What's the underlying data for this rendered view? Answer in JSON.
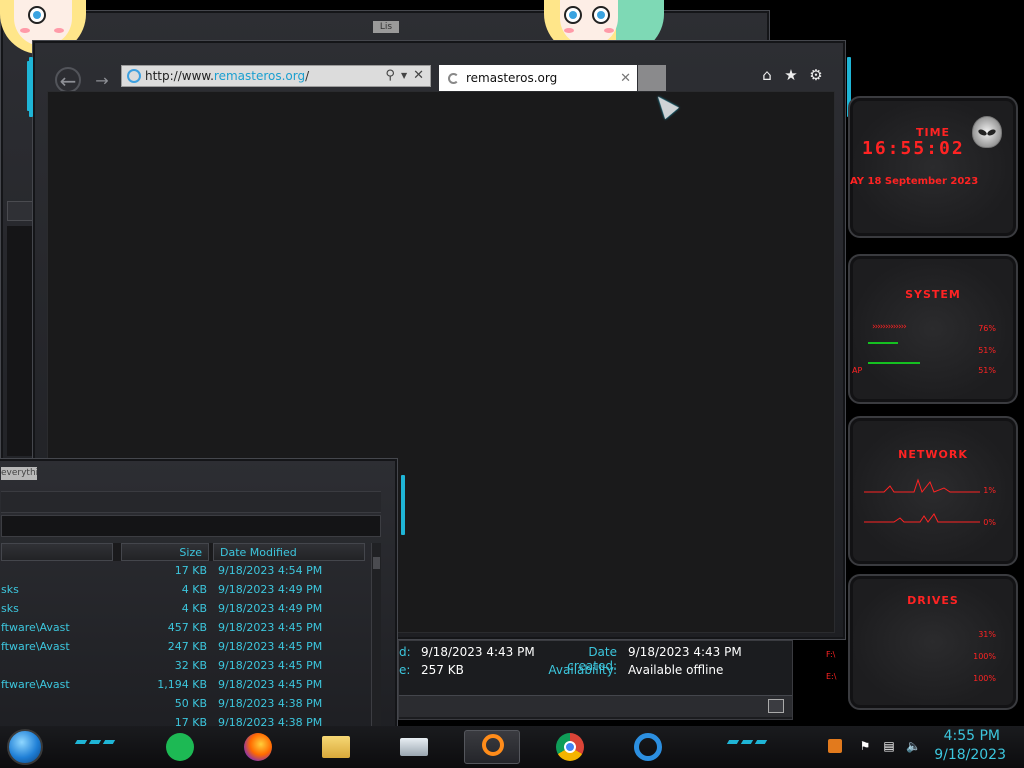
{
  "back_window": {
    "tag": "Lis"
  },
  "browser": {
    "address": {
      "prefix": "http://www.",
      "host": "remasteros.org",
      "suffix": "/"
    },
    "tab": {
      "title": "remasteros.org"
    }
  },
  "explorer": {
    "title": "everything",
    "columns": {
      "size": "Size",
      "date": "Date Modified"
    },
    "rows": [
      {
        "name": "",
        "size": "17 KB",
        "date": "9/18/2023 4:54 PM"
      },
      {
        "name": "sks",
        "size": "4 KB",
        "date": "9/18/2023 4:49 PM"
      },
      {
        "name": "sks",
        "size": "4 KB",
        "date": "9/18/2023 4:49 PM"
      },
      {
        "name": "ftware\\Avast",
        "size": "457 KB",
        "date": "9/18/2023 4:45 PM"
      },
      {
        "name": "ftware\\Avast",
        "size": "247 KB",
        "date": "9/18/2023 4:45 PM"
      },
      {
        "name": "",
        "size": "32 KB",
        "date": "9/18/2023 4:45 PM"
      },
      {
        "name": "ftware\\Avast",
        "size": "1,194 KB",
        "date": "9/18/2023 4:45 PM"
      },
      {
        "name": "",
        "size": "50 KB",
        "date": "9/18/2023 4:38 PM"
      },
      {
        "name": "",
        "size": "17 KB",
        "date": "9/18/2023 4:38 PM"
      }
    ]
  },
  "details": {
    "label1": "d:",
    "value1": "9/18/2023 4:43 PM",
    "label2": "e:",
    "value2": "257 KB",
    "label3": "Date created:",
    "value3": "9/18/2023 4:43 PM",
    "label4": "Availability:",
    "value4": "Available offline"
  },
  "gadgets": {
    "time": {
      "title": "TIME",
      "clock": "16:55:02",
      "date": "AY 18 September 2023"
    },
    "system": {
      "title": "SYSTEM",
      "val1": "76%",
      "val2": "51%",
      "val3": "51%",
      "label3": "AP"
    },
    "network": {
      "title": "NETWORK",
      "val1": "1%",
      "val2": "0%"
    },
    "drives": {
      "title": "DRIVES",
      "val1": "31%",
      "label2": "F:\\",
      "val2": "100%",
      "label3": "E:\\",
      "val3": "100%"
    }
  },
  "taskbar": {
    "time": "4:55 PM",
    "date": "9/18/2023",
    "apps": [
      "spotify-icon",
      "firefox-icon",
      "file-explorer-icon",
      "network-app-icon",
      "search-app-icon",
      "chrome-icon",
      "internet-explorer-icon"
    ]
  },
  "colors": {
    "accent": "#1fb5d6",
    "gadget_red": "#ff2323",
    "text_cyan": "#3cc6dd"
  }
}
